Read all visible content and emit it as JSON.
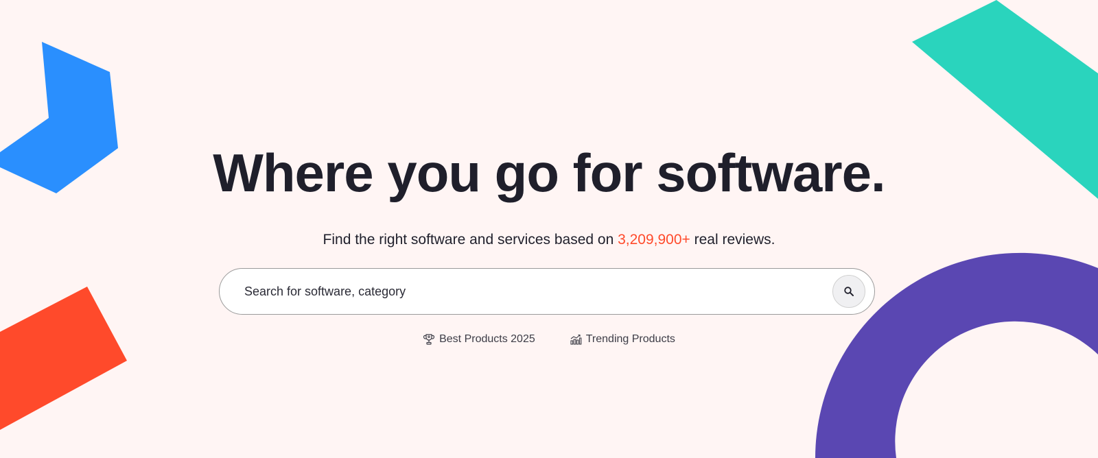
{
  "hero": {
    "headline": "Where you go for software.",
    "subline_prefix": "Find the right software and services based on ",
    "subline_count": "3,209,900+",
    "subline_suffix": " real reviews."
  },
  "search": {
    "placeholder": "Search for software, category",
    "button_icon": "search-icon"
  },
  "quick_links": [
    {
      "label": "Best Products 2025",
      "icon": "trophy-icon"
    },
    {
      "label": "Trending Products",
      "icon": "trending-chart-icon"
    }
  ],
  "colors": {
    "background": "#fff5f4",
    "headline": "#1f1f2b",
    "accent_count": "#ff4a2b",
    "shape_blue": "#2a8ffe",
    "shape_teal": "#2ad4bd",
    "shape_red": "#ff4a2b",
    "shape_purple": "#5a47b2"
  }
}
